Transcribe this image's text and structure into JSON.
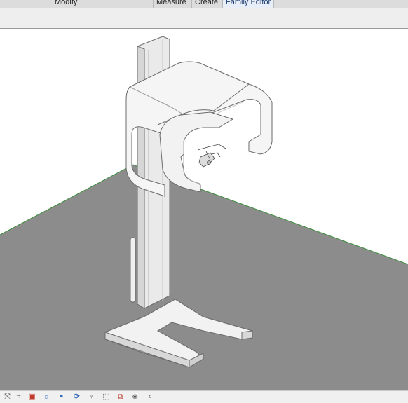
{
  "ribbon": {
    "tabs": [
      {
        "label": "Modify"
      },
      {
        "label": "Measure"
      },
      {
        "label": "Create"
      },
      {
        "label": "Family Editor"
      }
    ]
  },
  "viewport": {
    "background_color": "#ffffff",
    "floor_color": "#8c8c8c",
    "floor_edge_color": "#3f8f3f",
    "model_color": "#f4f4f4"
  },
  "view_control_bar": {
    "icons": [
      {
        "name": "scale-icon",
        "glyph": "⤧"
      },
      {
        "name": "detail-level-icon",
        "glyph": "≈"
      },
      {
        "name": "visual-style-icon",
        "glyph": "▣"
      },
      {
        "name": "sun-path-icon",
        "glyph": "☼"
      },
      {
        "name": "shadows-icon",
        "glyph": "◓"
      },
      {
        "name": "rendering-dialog-icon",
        "glyph": "⟳"
      },
      {
        "name": "lightbulb-icon",
        "glyph": "♀"
      },
      {
        "name": "crop-view-icon",
        "glyph": "⬚"
      },
      {
        "name": "show-crop-region-icon",
        "glyph": "⧉"
      },
      {
        "name": "temporary-hide-icon",
        "glyph": "◈"
      },
      {
        "name": "collapse-arrow-icon",
        "glyph": "‹"
      }
    ]
  }
}
